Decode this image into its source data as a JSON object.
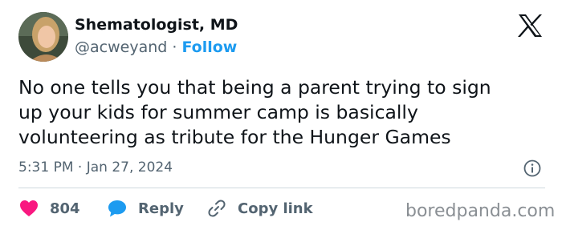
{
  "author": {
    "name": "Shematologist, MD",
    "handle": "@acweyand",
    "separator": "·",
    "follow_label": "Follow"
  },
  "tweet": {
    "text": "No one tells you that being a parent trying to sign\nup your kids for summer camp is basically\nvolunteering as tribute for the Hunger Games",
    "timestamp": "5:31 PM · Jan 27, 2024"
  },
  "actions": {
    "likes_count": "804",
    "reply_label": "Reply",
    "copy_link_label": "Copy link"
  },
  "watermark": "boredpanda.com",
  "icons": {
    "like": "heart-icon",
    "reply": "speech-bubble-icon",
    "copy": "link-icon",
    "info": "info-icon",
    "platform": "x-logo-icon"
  },
  "colors": {
    "like": "#f91880",
    "reply": "#1d9bf0",
    "follow": "#1d9bf0",
    "text": "#0f1419",
    "muted": "#536471"
  }
}
